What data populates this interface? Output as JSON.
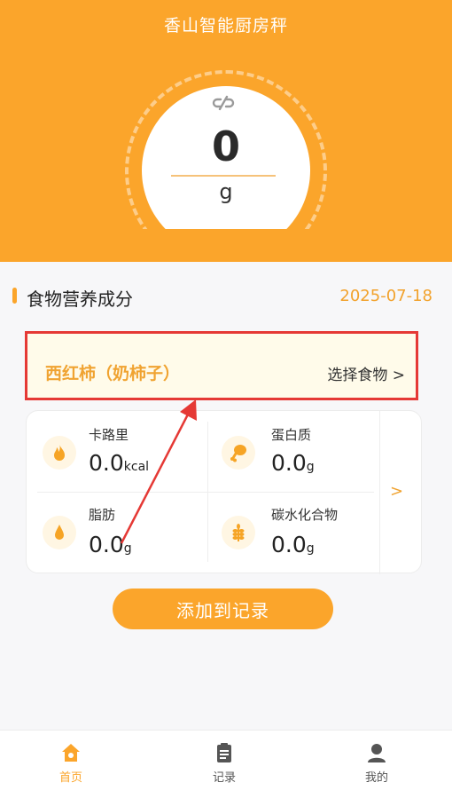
{
  "header": {
    "app_title": "香山智能厨房秤",
    "weight_value": "0",
    "weight_unit": "g"
  },
  "section": {
    "title": "食物营养成分",
    "date": "2025-07-18"
  },
  "food": {
    "name": "西红柿（奶柿子）",
    "choose_label": "选择食物 >"
  },
  "nutrients": [
    {
      "label": "卡路里",
      "value": "0.0",
      "unit": "kcal",
      "icon": "flame-icon"
    },
    {
      "label": "蛋白质",
      "value": "0.0",
      "unit": "g",
      "icon": "drumstick-icon"
    },
    {
      "label": "脂肪",
      "value": "0.0",
      "unit": "g",
      "icon": "drop-icon"
    },
    {
      "label": "碳水化合物",
      "value": "0.0",
      "unit": "g",
      "icon": "wheat-icon"
    }
  ],
  "more_label": ">",
  "add_button_label": "添加到记录",
  "nav": [
    {
      "label": "首页",
      "active": true
    },
    {
      "label": "记录",
      "active": false
    },
    {
      "label": "我的",
      "active": false
    }
  ],
  "colors": {
    "accent": "#fba52b",
    "accent_text": "#f0a331",
    "highlight_border": "#e53935",
    "nav_inactive": "#555555"
  }
}
